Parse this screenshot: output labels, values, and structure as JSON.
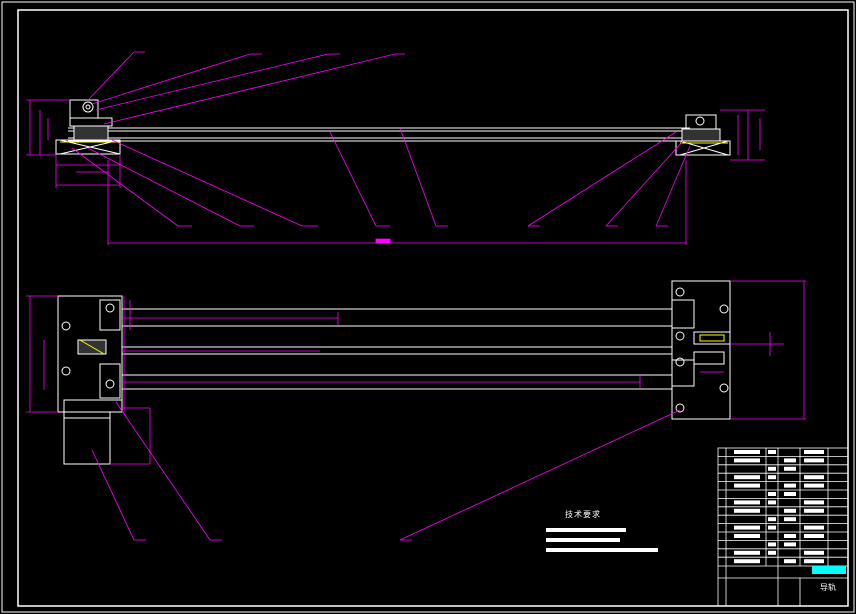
{
  "drawing": {
    "background_color": "#000000",
    "line_color": "#ffffff",
    "dimension_color": "#ff00ff",
    "hidden_color": "#ffff00",
    "table_accent_color": "#00ffff",
    "technical_requirements_title": "技术要求",
    "title_block_name": "导轨"
  }
}
